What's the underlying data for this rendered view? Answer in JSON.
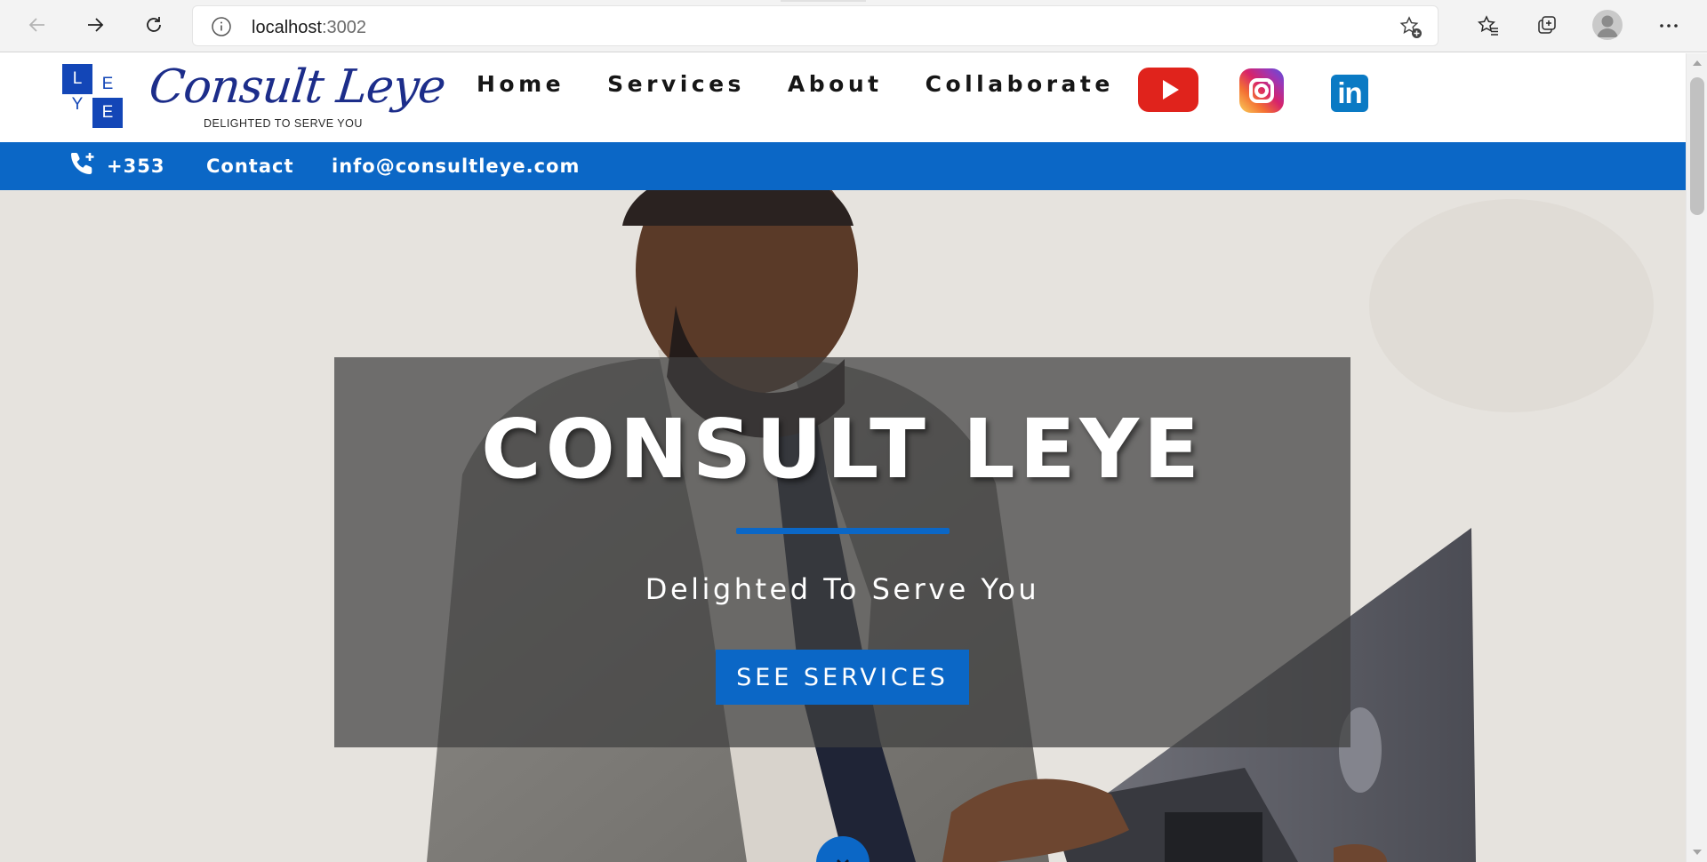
{
  "browser": {
    "url_host": "localhost",
    "url_port": ":3002",
    "icons": {
      "back": "arrow-left-icon",
      "forward": "arrow-right-icon",
      "reload": "reload-icon",
      "site_info": "info-icon",
      "add_favorite": "star-plus-icon",
      "favorites": "favorites-icon",
      "collections": "collections-icon",
      "profile": "avatar",
      "menu": "more-icon"
    }
  },
  "site": {
    "logo": {
      "letters": [
        "L",
        "E",
        "Y",
        "E"
      ],
      "script": "Consult Leye",
      "tagline": "DELIGHTED TO SERVE YOU"
    },
    "nav": [
      "Home",
      "Services",
      "About",
      "Collaborate"
    ],
    "social": [
      "youtube-icon",
      "instagram-icon",
      "linkedin-icon"
    ],
    "linkedin_text": "in",
    "contact": {
      "phone": "+353",
      "contact_label": "Contact",
      "email": "info@consultleye.com"
    },
    "hero": {
      "title": "CONSULT LEYE",
      "subtitle": "Delighted To Serve You",
      "button": "SEE SERVICES"
    }
  },
  "colors": {
    "brand_blue": "#0b67c6",
    "logo_blue": "#1346b7",
    "youtube_red": "#e0231c",
    "linkedin_blue": "#0a7ac4"
  }
}
